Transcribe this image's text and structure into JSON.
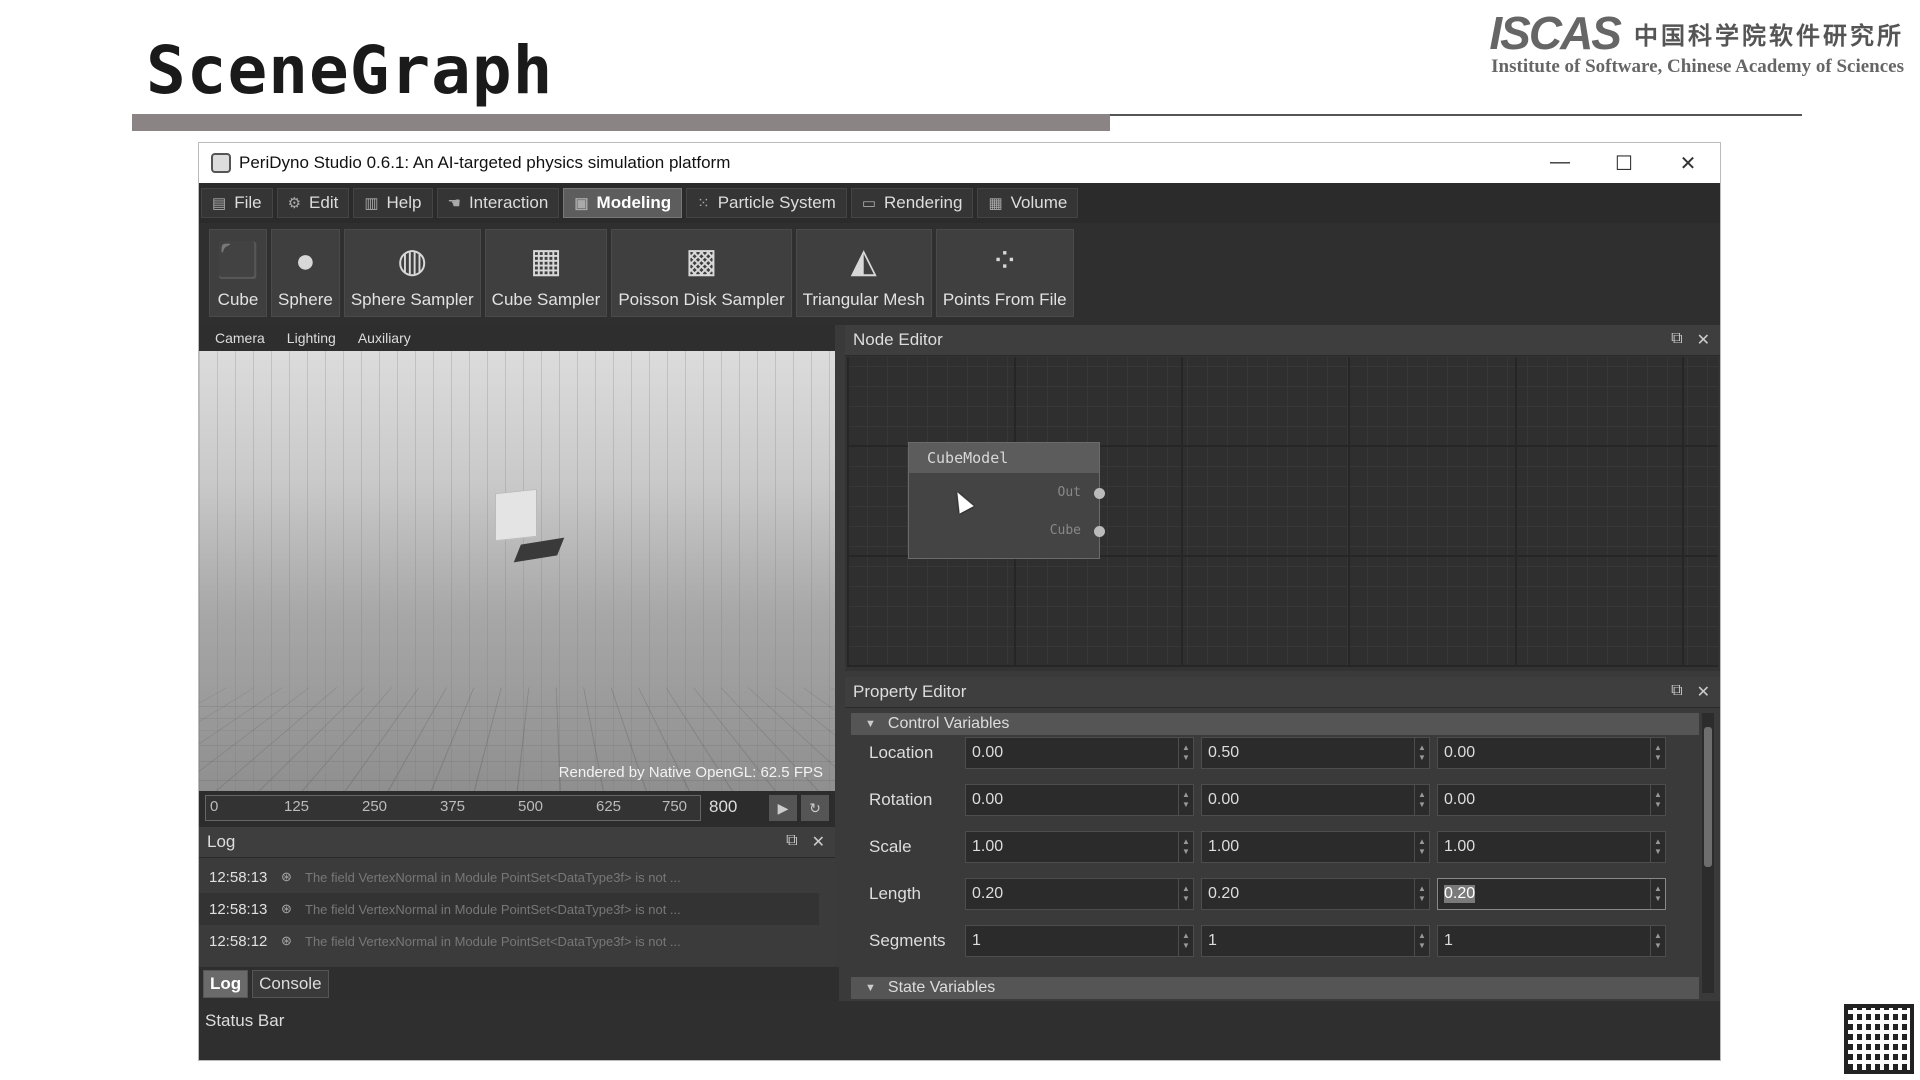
{
  "slide": {
    "title": "SceneGraph",
    "logo_mark": "ISCAS",
    "logo_cn": "中国科学院软件研究所",
    "logo_en": "Institute of Software, Chinese Academy of Sciences"
  },
  "window": {
    "title": "PeriDyno Studio 0.6.1:  An AI-targeted physics simulation platform",
    "controls": {
      "minimize": "—",
      "maximize": "☐",
      "close": "✕"
    }
  },
  "menubar": {
    "items": [
      {
        "label": "File",
        "icon": "file-icon"
      },
      {
        "label": "Edit",
        "icon": "gear-icon"
      },
      {
        "label": "Help",
        "icon": "book-icon"
      },
      {
        "label": "Interaction",
        "icon": "pointer-icon"
      },
      {
        "label": "Modeling",
        "icon": "modeling-icon",
        "active": true
      },
      {
        "label": "Particle System",
        "icon": "particles-icon"
      },
      {
        "label": "Rendering",
        "icon": "monitor-icon"
      },
      {
        "label": "Volume",
        "icon": "volume-icon"
      }
    ]
  },
  "toolbar": {
    "items": [
      {
        "label": "Cube",
        "icon": "cube-icon",
        "glyph": "⬛"
      },
      {
        "label": "Sphere",
        "icon": "sphere-icon",
        "glyph": "●"
      },
      {
        "label": "Sphere Sampler",
        "icon": "sphere-sampler-icon",
        "glyph": "◍"
      },
      {
        "label": "Cube Sampler",
        "icon": "cube-sampler-icon",
        "glyph": "▦"
      },
      {
        "label": "Poisson Disk Sampler",
        "icon": "poisson-disk-icon",
        "glyph": "▩"
      },
      {
        "label": "Triangular Mesh",
        "icon": "triangular-mesh-icon",
        "glyph": "◭"
      },
      {
        "label": "Points From File",
        "icon": "points-icon",
        "glyph": "⁘"
      }
    ]
  },
  "viewport": {
    "tabs": [
      "Camera",
      "Lighting",
      "Auxiliary"
    ],
    "render_info": "Rendered by Native OpenGL: 62.5 FPS"
  },
  "timeline": {
    "ticks": [
      "0",
      "125",
      "250",
      "375",
      "500",
      "625",
      "750"
    ],
    "frame": "800"
  },
  "log": {
    "title": "Log",
    "entries": [
      {
        "time": "12:58:13",
        "message": "The field VertexNormal in Module PointSet<DataType3f> is not ..."
      },
      {
        "time": "12:58:13",
        "message": "The field VertexNormal in Module PointSet<DataType3f> is not ..."
      },
      {
        "time": "12:58:12",
        "message": "The field VertexNormal in Module PointSet<DataType3f> is not ..."
      }
    ],
    "tabs": [
      "Log",
      "Console"
    ]
  },
  "status_bar": "Status Bar",
  "node_editor": {
    "title": "Node Editor",
    "node": {
      "title": "CubeModel",
      "ports": [
        "Out",
        "Cube"
      ]
    }
  },
  "property_editor": {
    "title": "Property Editor",
    "sections": {
      "control": "Control Variables",
      "state": "State Variables"
    },
    "rows": [
      {
        "label": "Location",
        "values": [
          "0.00",
          "0.50",
          "0.00"
        ]
      },
      {
        "label": "Rotation",
        "values": [
          "0.00",
          "0.00",
          "0.00"
        ]
      },
      {
        "label": "Scale",
        "values": [
          "1.00",
          "1.00",
          "1.00"
        ]
      },
      {
        "label": "Length",
        "values": [
          "0.20",
          "0.20",
          "0.20"
        ]
      },
      {
        "label": "Segments",
        "values": [
          "1",
          "1",
          "1"
        ]
      }
    ]
  }
}
